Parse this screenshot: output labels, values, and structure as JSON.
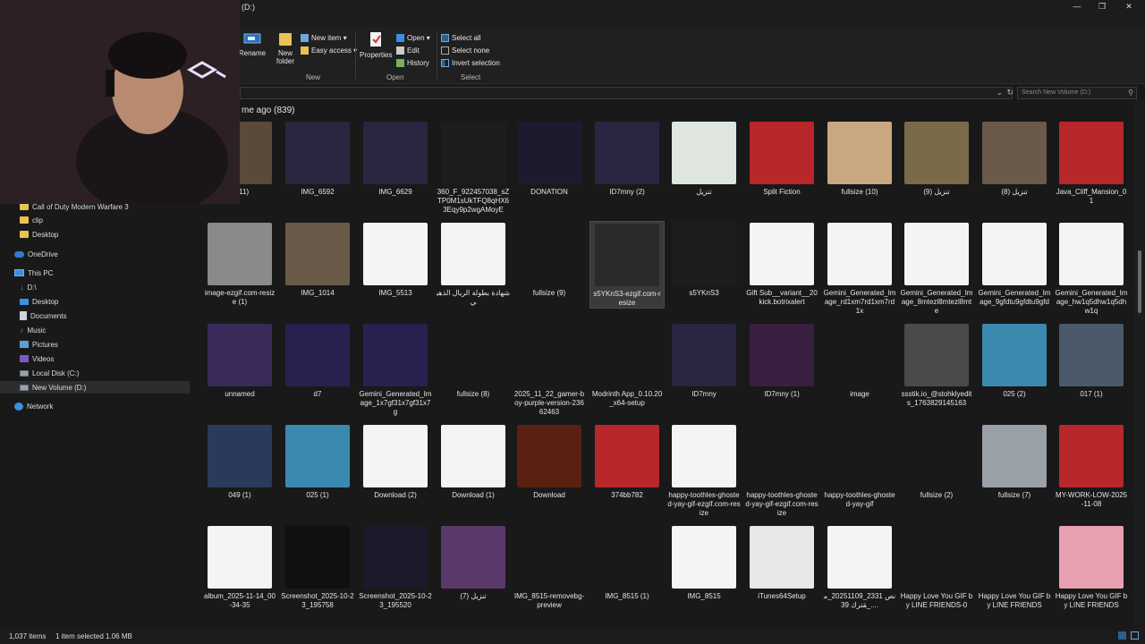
{
  "window": {
    "title": "(D:)",
    "minimize": "—",
    "restore": "❐",
    "close": "✕"
  },
  "ribbon": {
    "rename": "Rename",
    "new_folder": "New folder",
    "new_item": "New item ▾",
    "easy_access": "Easy access ▾",
    "properties": "Properties",
    "open": "Open ▾",
    "edit": "Edit",
    "history": "History",
    "select_all": "Select all",
    "select_none": "Select none",
    "invert_selection": "Invert selection",
    "group_new": "New",
    "group_open": "Open",
    "group_select": "Select"
  },
  "address": {
    "search_placeholder": "Search New Volume (D:)"
  },
  "sidebar": {
    "items": [
      {
        "label": "Call of Duty Modern Warfare 3",
        "icon": "folder-icon"
      },
      {
        "label": "clip",
        "icon": "folder-icon"
      },
      {
        "label": "Desktop",
        "icon": "folder-icon"
      },
      {
        "label": "OneDrive",
        "icon": "cloud-icon"
      },
      {
        "label": "This PC",
        "icon": "computer-icon"
      },
      {
        "label": "D:\\",
        "icon": "download-icon"
      },
      {
        "label": "Desktop",
        "icon": "desktop-icon"
      },
      {
        "label": "Documents",
        "icon": "documents-icon"
      },
      {
        "label": "Music",
        "icon": "music-icon"
      },
      {
        "label": "Pictures",
        "icon": "pictures-icon"
      },
      {
        "label": "Videos",
        "icon": "videos-icon"
      },
      {
        "label": "Local Disk (C:)",
        "icon": "drive-icon"
      },
      {
        "label": "New Volume (D:)",
        "icon": "drive-icon"
      },
      {
        "label": "Network",
        "icon": "network-icon"
      }
    ]
  },
  "content": {
    "group_header": "me ago (839)",
    "files": [
      {
        "name": "e (11)",
        "color": "#5a4a3a"
      },
      {
        "name": "IMG_6592",
        "color": "#2b2540"
      },
      {
        "name": "IMG_6629",
        "color": "#2b2540"
      },
      {
        "name": "360_F_922457038_sZTP0M1sUkTFQ8qHX63Eqy9p2wgAMoyE",
        "color": "#1d1d1d"
      },
      {
        "name": "DONATION",
        "color": "#1e1a2e"
      },
      {
        "name": "ID7mny (2)",
        "color": "#2a2540"
      },
      {
        "name": "تنزيل",
        "color": "#dfe6e0"
      },
      {
        "name": "Split Fiction",
        "color": "#b8272a"
      },
      {
        "name": "fullsize (10)",
        "color": "#c8a880"
      },
      {
        "name": "تنزيل (9)",
        "color": "#7a6a4a"
      },
      {
        "name": "تنزيل (8)",
        "color": "#6a5a4a"
      },
      {
        "name": "Java_Cliff_Mansion_01",
        "color": "#b8272a"
      },
      {
        "name": "image-ezgif.com-resize (1)",
        "color": "#8a8a8a"
      },
      {
        "name": "IMG_1014",
        "color": "#6a5a4a"
      },
      {
        "name": "IMG_5513",
        "color": "#f4f4f4"
      },
      {
        "name": "شهادة بطولة الريال الذهبي",
        "color": "#f4f4f4"
      },
      {
        "name": "fullsize (9)",
        "color": "#181818"
      },
      {
        "name": "s5YKnS3-ezgif.com-resize",
        "color": "#2a2a2a"
      },
      {
        "name": "s5YKnS3",
        "color": "#1d1d1d"
      },
      {
        "name": "Gift Sub__variant__20kick.botrixalert",
        "color": "#f4f4f4"
      },
      {
        "name": "Gemini_Generated_Image_rd1xm7rd1xm7rd1x",
        "color": "#f4f4f4"
      },
      {
        "name": "Gemini_Generated_Image_8mtezl8mtezl8mte",
        "color": "#f4f4f4"
      },
      {
        "name": "Gemini_Generated_Image_9gfdtu9gfdtu9gfd",
        "color": "#f4f4f4"
      },
      {
        "name": "Gemini_Generated_Image_hw1q5dhw1q5dhw1q",
        "color": "#f4f4f4"
      },
      {
        "name": "unnamed",
        "color": "#3a2a5a"
      },
      {
        "name": "d7",
        "color": "#2a2050"
      },
      {
        "name": "Gemini_Generated_Image_1x7gf31x7gf31x7g",
        "color": "#2a2050"
      },
      {
        "name": "fullsize (8)",
        "color": "#181818"
      },
      {
        "name": "2025_11_22_gamer-boy-purple-version-23662463",
        "color": "#181818"
      },
      {
        "name": "Modrinth App_0.10.20_x64-setup",
        "color": "#181818"
      },
      {
        "name": "ID7mny",
        "color": "#2a2540"
      },
      {
        "name": "ID7mny (1)",
        "color": "#3a2040"
      },
      {
        "name": "image",
        "color": "#181818"
      },
      {
        "name": "ssstik.io_@stohklyedits_1763829145163",
        "color": "#4a4a4a"
      },
      {
        "name": "025 (2)",
        "color": "#3a8ab0"
      },
      {
        "name": "017 (1)",
        "color": "#4a5a6a"
      },
      {
        "name": "049 (1)",
        "color": "#2a3a5a"
      },
      {
        "name": "025 (1)",
        "color": "#3a8ab0"
      },
      {
        "name": "Download (2)",
        "color": "#f4f4f4"
      },
      {
        "name": "Download (1)",
        "color": "#f4f4f4"
      },
      {
        "name": "Download",
        "color": "#5a2010"
      },
      {
        "name": "374bb782",
        "color": "#b8272a"
      },
      {
        "name": "happy-toothles-ghosted-yay-gif-ezgif.com-resize",
        "color": "#f4f4f4"
      },
      {
        "name": "happy-toothles-ghosted-yay-gif-ezgif.com-resize",
        "color": "#181818"
      },
      {
        "name": "happy-toothles-ghosted-yay-gif",
        "color": "#181818"
      },
      {
        "name": "fullsize (2)",
        "color": "#181818"
      },
      {
        "name": "fullsize (7)",
        "color": "#9aa0a8"
      },
      {
        "name": "MY-WORK-LOW-2025-11-08",
        "color": "#b8272a"
      },
      {
        "name": "album_2025-11-14_00-34-35",
        "color": "#f4f4f4"
      },
      {
        "name": "Screenshot_2025-10-23_195758",
        "color": "#101010"
      },
      {
        "name": "Screenshot_2025-10-23_195520",
        "color": "#1a1a2a"
      },
      {
        "name": "تنزيل (7)",
        "color": "#5a3a6a"
      },
      {
        "name": "IMG_8515-removebg-preview",
        "color": "#181818"
      },
      {
        "name": "IMG_8515 (1)",
        "color": "#181818"
      },
      {
        "name": "IMG_8515",
        "color": "#f4f4f4"
      },
      {
        "name": "iTunes64Setup",
        "color": "#e8e8e8"
      },
      {
        "name": "نص 2331_20251109_مقترك 39_....",
        "color": "#f4f4f4"
      },
      {
        "name": "Happy Love You GIF by LINE FRIENDS-0",
        "color": "#181818"
      },
      {
        "name": "Happy Love You GIF by LINE FRIENDS",
        "color": "#181818"
      },
      {
        "name": "Happy Love You GIF by LINE FRIENDS",
        "color": "#e8a0b0"
      }
    ]
  },
  "status": {
    "count": "1,037 items",
    "selected": "1 item selected  1.06 MB"
  }
}
